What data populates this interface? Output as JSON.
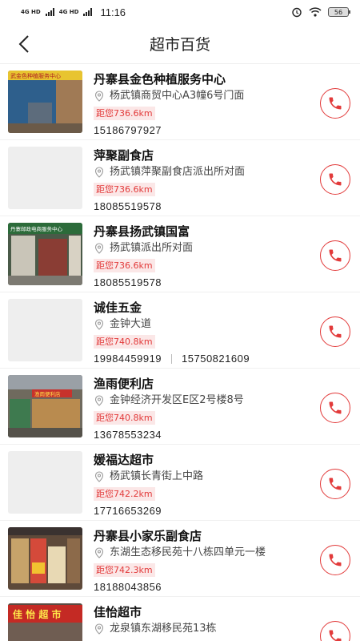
{
  "status": {
    "net1": "4G HD",
    "net2": "4G HD",
    "time": "11:16",
    "battery": "56"
  },
  "header": {
    "title": "超市百货"
  },
  "stores": [
    {
      "name": "丹寨县金色种植服务中心",
      "address": "杨武镇商贸中心A3幢6号门面",
      "distance": "距您736.6km",
      "phone": "15186797927",
      "phone2": ""
    },
    {
      "name": "萍聚副食店",
      "address": "扬武镇萍聚副食店派出所对面",
      "distance": "距您736.6km",
      "phone": "18085519578",
      "phone2": ""
    },
    {
      "name": "丹寨县扬武镇国富",
      "address": "扬武镇派出所对面",
      "distance": "距您736.6km",
      "phone": "18085519578",
      "phone2": ""
    },
    {
      "name": "诚佳五金",
      "address": "金钟大道",
      "distance": "距您740.8km",
      "phone": "19984459919",
      "phone2": "15750821609"
    },
    {
      "name": "渔雨便利店",
      "address": "金钟经济开发区E区2号楼8号",
      "distance": "距您740.8km",
      "phone": "13678553234",
      "phone2": ""
    },
    {
      "name": "媛福达超市",
      "address": "杨武镇长青街上中路",
      "distance": "距您742.2km",
      "phone": "17716653269",
      "phone2": ""
    },
    {
      "name": "丹寨县小家乐副食店",
      "address": "东湖生态移民苑十八栋四单元一楼",
      "distance": "距您742.3km",
      "phone": "18188043856",
      "phone2": ""
    },
    {
      "name": "佳怡超市",
      "address": "龙泉镇东湖移民苑13栋",
      "distance": "",
      "phone": "",
      "phone2": ""
    }
  ],
  "thumb_signs": {
    "s0": "武金色种植服务中心",
    "s2": "丹寨邮政电商服务中心",
    "s4": "渔雨便利店",
    "s7": "佳 怡 超 市"
  }
}
